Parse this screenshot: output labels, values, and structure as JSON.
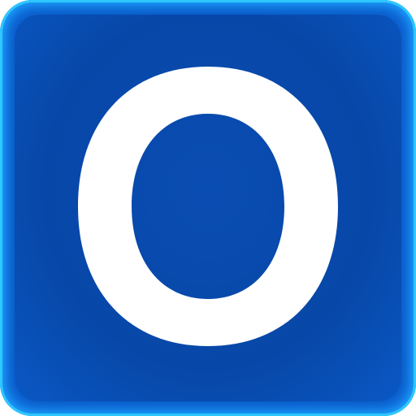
{
  "icon": {
    "letter": "O",
    "colors": {
      "background": "#0750b8",
      "glow": "#2ec8ff",
      "letter": "#ffffff"
    }
  }
}
